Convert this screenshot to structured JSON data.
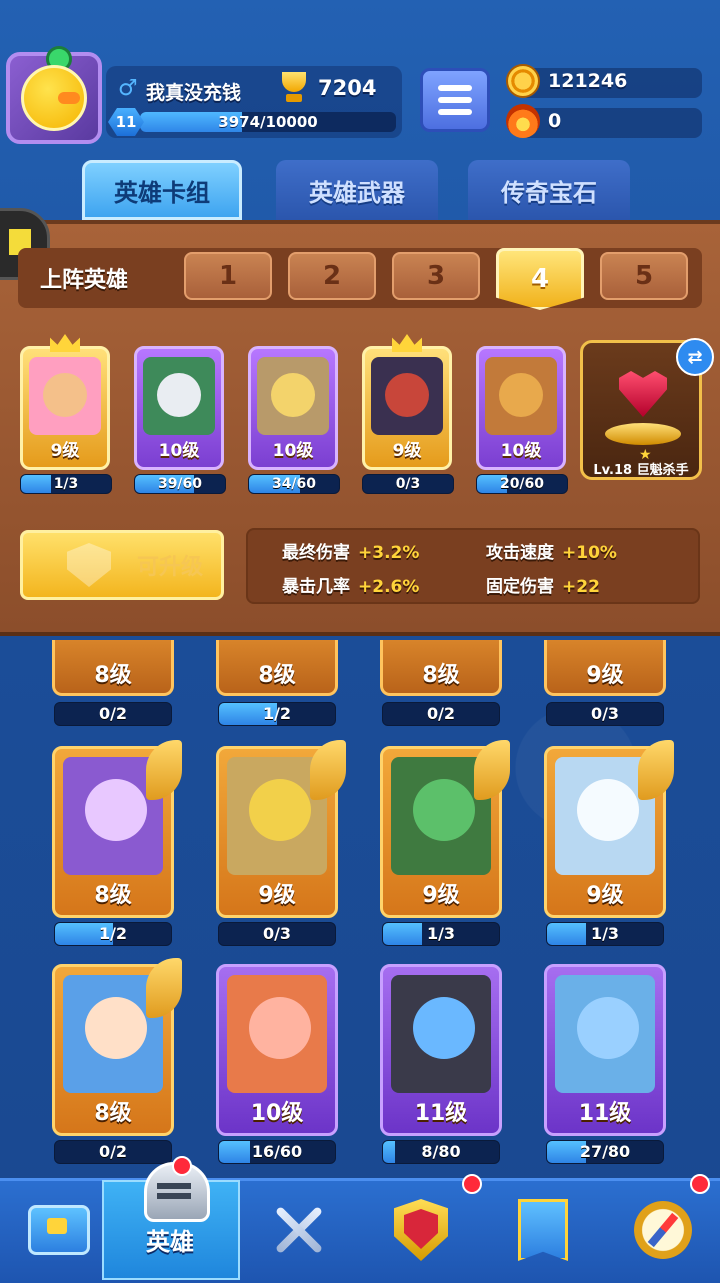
{
  "player": {
    "name": "我真没充钱",
    "gender_icon": "male-symbol-icon",
    "trophies": "7204",
    "level": "11",
    "xp_text": "3974/10000",
    "xp_fraction": 0.3974
  },
  "currency": {
    "coins": "121246",
    "flames": "0"
  },
  "tabs": [
    {
      "label": "英雄卡组",
      "active": true
    },
    {
      "label": "英雄武器",
      "active": false
    },
    {
      "label": "传奇宝石",
      "active": false
    }
  ],
  "lineup": {
    "title": "上阵英雄",
    "slots": [
      "1",
      "2",
      "3",
      "4",
      "5"
    ],
    "active_slot": "4",
    "heroes": [
      {
        "level": "9级",
        "progress": "1/3",
        "fraction": 0.333,
        "rarity": "gold",
        "crown": true
      },
      {
        "level": "10级",
        "progress": "39/60",
        "fraction": 0.65,
        "rarity": "purple",
        "crown": false
      },
      {
        "level": "10级",
        "progress": "34/60",
        "fraction": 0.567,
        "rarity": "purple",
        "crown": false
      },
      {
        "level": "9级",
        "progress": "0/3",
        "fraction": 0,
        "rarity": "gold",
        "crown": true
      },
      {
        "level": "10级",
        "progress": "20/60",
        "fraction": 0.333,
        "rarity": "purple",
        "crown": false
      }
    ],
    "gem": {
      "label": "Lv.18 巨魁杀手"
    },
    "upgrade_label": "可升级",
    "stats": [
      {
        "name": "最终伤害",
        "value": "+3.2%"
      },
      {
        "name": "攻击速度",
        "value": "+10%"
      },
      {
        "name": "暴击几率",
        "value": "+2.6%"
      },
      {
        "name": "固定伤害",
        "value": "+22"
      }
    ]
  },
  "collection": {
    "top_row": [
      {
        "level": "8级",
        "progress": "0/2",
        "fraction": 0
      },
      {
        "level": "8级",
        "progress": "1/2",
        "fraction": 0.5
      },
      {
        "level": "8级",
        "progress": "0/2",
        "fraction": 0
      },
      {
        "level": "9级",
        "progress": "0/3",
        "fraction": 0
      }
    ],
    "row2": [
      {
        "level": "8级",
        "progress": "1/2",
        "fraction": 0.5,
        "rarity": "gold"
      },
      {
        "level": "9级",
        "progress": "0/3",
        "fraction": 0,
        "rarity": "gold"
      },
      {
        "level": "9级",
        "progress": "1/3",
        "fraction": 0.333,
        "rarity": "gold"
      },
      {
        "level": "9级",
        "progress": "1/3",
        "fraction": 0.333,
        "rarity": "gold"
      }
    ],
    "row3": [
      {
        "level": "8级",
        "progress": "0/2",
        "fraction": 0,
        "rarity": "gold"
      },
      {
        "level": "10级",
        "progress": "16/60",
        "fraction": 0.267,
        "rarity": "purple"
      },
      {
        "level": "11级",
        "progress": "8/80",
        "fraction": 0.1,
        "rarity": "purple"
      },
      {
        "level": "11级",
        "progress": "27/80",
        "fraction": 0.338,
        "rarity": "purple"
      }
    ]
  },
  "nav": {
    "items": [
      "chest-icon",
      "helmet-icon",
      "swords-icon",
      "shield-icon",
      "banner-icon",
      "compass-icon"
    ],
    "active_label": "英雄"
  }
}
